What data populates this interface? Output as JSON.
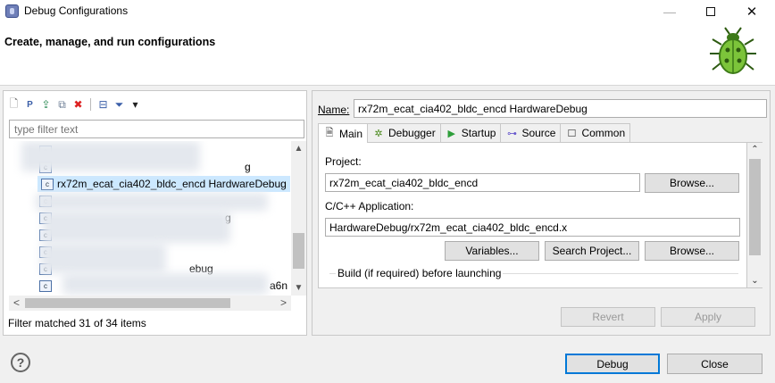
{
  "window": {
    "title": "Debug Configurations",
    "minimize_glyph": "—",
    "close_glyph": "✕"
  },
  "banner": {
    "title": "Create, manage, and run configurations",
    "icon": "bug-icon"
  },
  "left": {
    "toolbar": [
      {
        "name": "new-configuration-icon",
        "glyph": "🗋"
      },
      {
        "name": "new-prototype-icon",
        "glyph": "P"
      },
      {
        "name": "export-icon",
        "glyph": "⇪"
      },
      {
        "name": "duplicate-icon",
        "glyph": "⧉"
      },
      {
        "name": "delete-icon",
        "glyph": "✖"
      },
      {
        "name": "collapse-all-icon",
        "glyph": "⊟"
      },
      {
        "name": "filter-icon",
        "glyph": "⏷"
      },
      {
        "name": "view-menu-icon",
        "glyph": "▾"
      }
    ],
    "filter_placeholder": "type filter text",
    "tree": {
      "selected_item": "rx72m_ecat_cia402_bldc_encd HardwareDebug",
      "partial_item_1": "g",
      "partial_item_2": "g",
      "partial_item_3": "ebug",
      "partial_item_4": "a6n",
      "icon_glyph": "c"
    },
    "filter_status": "Filter matched 31 of 34 items",
    "scroll_up": "▲",
    "scroll_down": "▼",
    "scroll_left": "<",
    "scroll_right": ">"
  },
  "right": {
    "name_label": "Name:",
    "name_value": "rx72m_ecat_cia402_bldc_encd HardwareDebug",
    "tabs": [
      {
        "label": "Main",
        "icon": "main-tab-icon",
        "glyph": "🗎",
        "active": true
      },
      {
        "label": "Debugger",
        "icon": "debugger-tab-icon",
        "glyph": "✲",
        "active": false
      },
      {
        "label": "Startup",
        "icon": "startup-tab-icon",
        "glyph": "▶",
        "active": false
      },
      {
        "label": "Source",
        "icon": "source-tab-icon",
        "glyph": "⊶",
        "active": false
      },
      {
        "label": "Common",
        "icon": "common-tab-icon",
        "glyph": "☐",
        "active": false
      }
    ],
    "project_label": "Project:",
    "project_value": "rx72m_ecat_cia402_bldc_encd",
    "browse_label": "Browse...",
    "app_label": "C/C++ Application:",
    "app_value": "HardwareDebug/rx72m_ecat_cia402_bldc_encd.x",
    "variables_label": "Variables...",
    "search_project_label": "Search Project...",
    "build_group_label": "Build (if required) before launching",
    "revert_label": "Revert",
    "apply_label": "Apply",
    "scroll_up": "⌃",
    "scroll_down": "⌄"
  },
  "footer": {
    "help_glyph": "?",
    "debug_label": "Debug",
    "close_label": "Close"
  },
  "colors": {
    "selection": "#cce8ff",
    "accent": "#0078d7"
  }
}
